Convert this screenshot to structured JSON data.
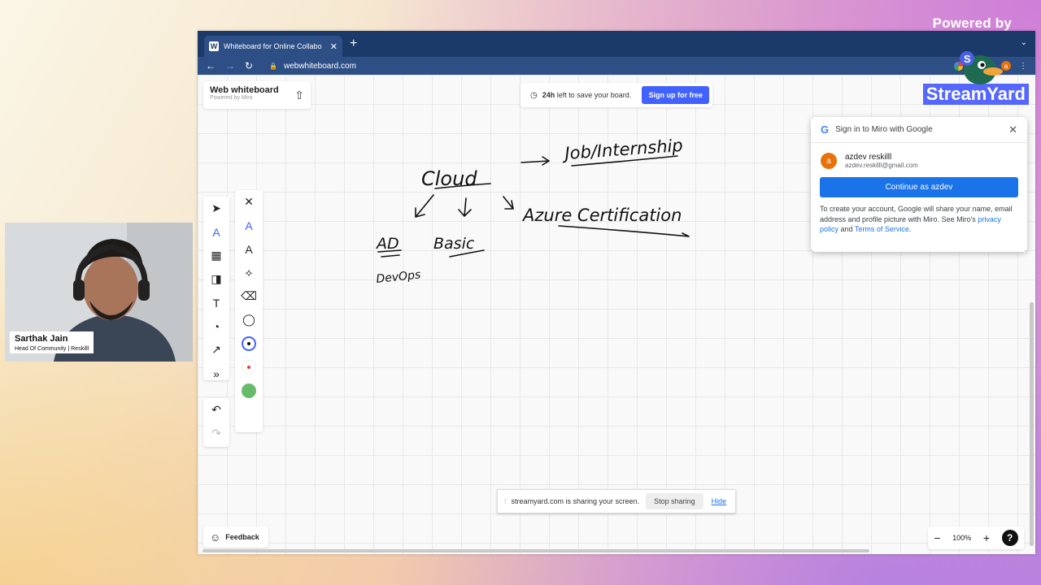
{
  "overlay": {
    "powered_by": "Powered by"
  },
  "browser": {
    "tab_title": "Whiteboard for Online Collabo",
    "tab_favicon": "W",
    "url": "webwhiteboard.com"
  },
  "board": {
    "brand_title": "Web whiteboard",
    "brand_sub": "Powered by Miro",
    "save_banner": {
      "bold": "24h",
      "text": " left to save your board."
    },
    "signup_label": "Sign up for free",
    "streamyard_logo": "StreamYard"
  },
  "google_popup": {
    "title": "Sign in to Miro with Google",
    "account_name": "azdev reskilll",
    "account_email": "azdev.reskilll@gmail.com",
    "avatar_letter": "a",
    "continue_label": "Continue as azdev",
    "note_prefix": "To create your account, Google will share your name, email address and profile picture with Miro. See Miro's ",
    "privacy_link": "privacy policy",
    "and_text": " and ",
    "terms_link": "Terms of Service",
    "period": "."
  },
  "handwriting": {
    "cloud": "Cloud",
    "job": "Job/Internship",
    "azure": "Azure Certification",
    "ad": "AD",
    "basic": "Basic",
    "devops": "DevOps"
  },
  "share_bar": {
    "text": "streamyard.com is sharing your screen.",
    "stop_label": "Stop sharing",
    "hide_label": "Hide"
  },
  "feedback_label": "Feedback",
  "zoom_level": "100%",
  "help_label": "?",
  "webcam": {
    "name": "Sarthak Jain",
    "role": "Head Of Community | Reskilll"
  },
  "colors": {
    "miro_blue": "#4262ff",
    "google_blue": "#1a73e8",
    "tab_bar": "#1c3a69",
    "red_dot": "#e53935",
    "green_dot": "#66bb6a"
  }
}
